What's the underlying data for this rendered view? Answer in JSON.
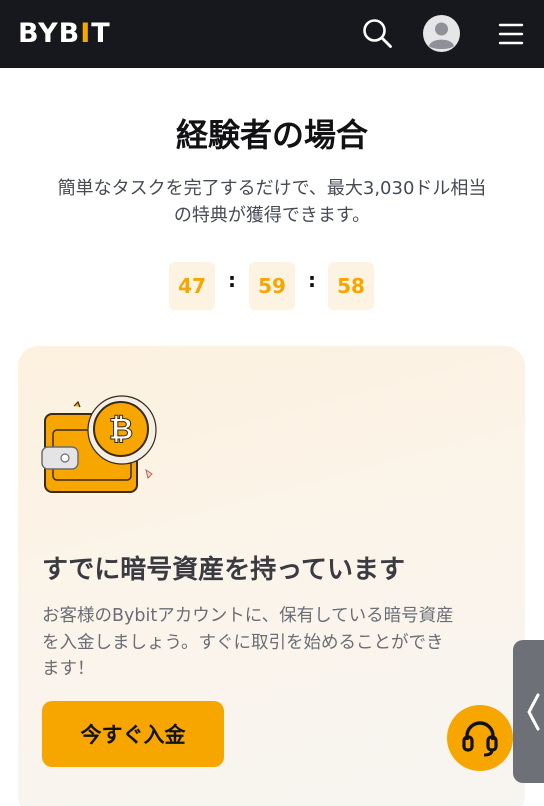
{
  "header": {
    "logo_prefix": "BYB",
    "logo_accent": "I",
    "logo_suffix": "T",
    "icons": [
      "search-icon",
      "avatar",
      "menu-icon"
    ]
  },
  "hero": {
    "title": "経験者の場合",
    "subtitle_line1": "簡単なタスクを完了するだけで、最大3,030ドル相当",
    "subtitle_line2": "の特典が獲得できます。"
  },
  "timer": {
    "hours": "47",
    "minutes": "59",
    "seconds": "58",
    "separator": ":"
  },
  "card": {
    "title": "すでに暗号資産を持っています",
    "description_line1": "お客様のBybitアカウントに、保有している暗号資産",
    "description_line2": "を入金しましょう。すぐに取引を始めることができ",
    "description_line3": "ます！",
    "button_label": "今すぐ入金",
    "illustration": "wallet-with-bitcoin-icon"
  },
  "floating": {
    "side_tab_icon": "chevron-left-icon",
    "support_icon": "headset-icon"
  },
  "colors": {
    "topbar": "#17181e",
    "accent": "#f7a600",
    "timer_bg": "#fdf3e3",
    "card_bg": "#fdf1df",
    "side_tab": "#6e7077"
  }
}
